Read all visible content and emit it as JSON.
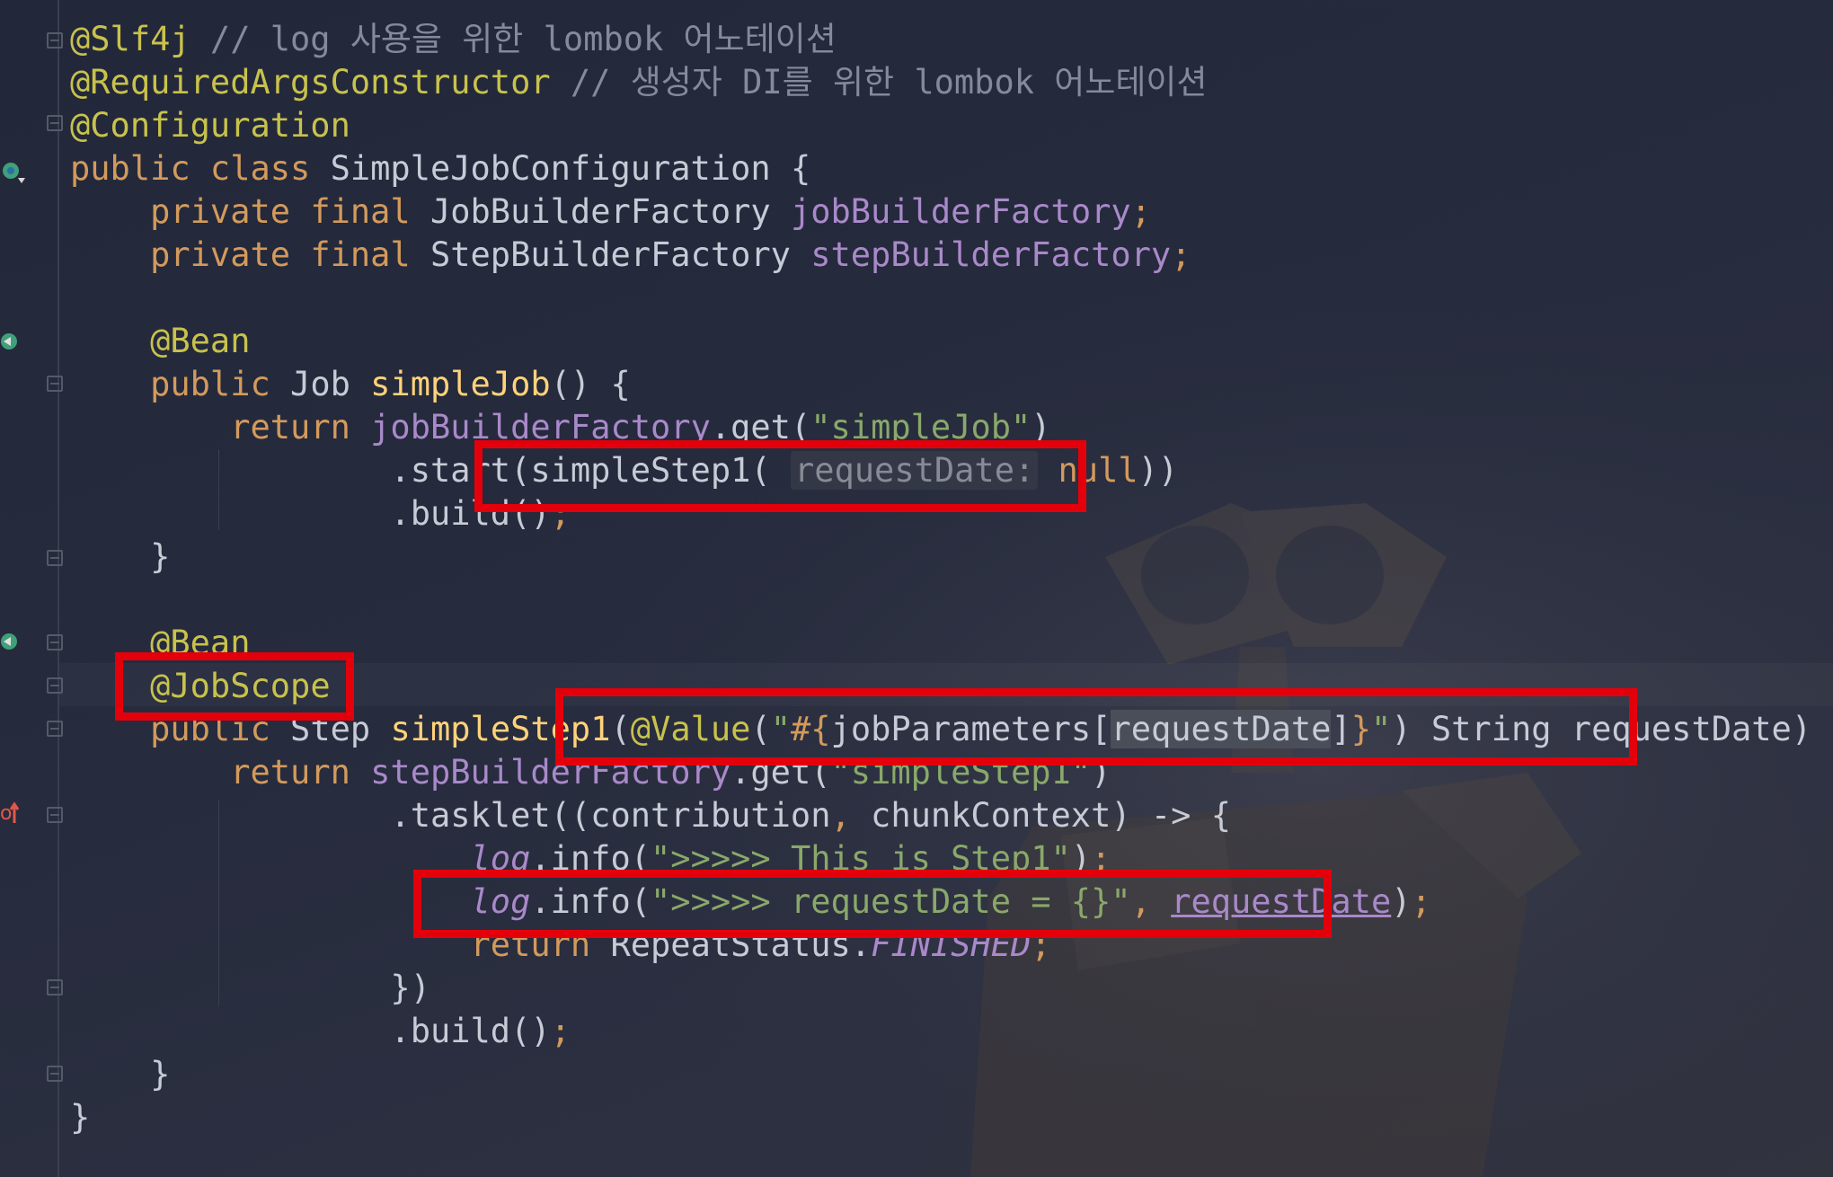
{
  "editor": {
    "lines": [
      [
        [
          "ann",
          "@Slf4j"
        ],
        [
          "cmt",
          " // log 사용을 위한 lombok 어노테이션"
        ]
      ],
      [
        [
          "ann",
          "@RequiredArgsConstructor"
        ],
        [
          "cmt",
          " // 생성자 DI를 위한 lombok 어노테이션"
        ]
      ],
      [
        [
          "ann",
          "@Configuration"
        ]
      ],
      [
        [
          "kw",
          "public class "
        ],
        [
          "",
          "SimpleJobConfiguration {"
        ]
      ],
      [
        [
          "",
          "    "
        ],
        [
          "kw",
          "private final "
        ],
        [
          "",
          "JobBuilderFactory "
        ],
        [
          "fld",
          "jobBuilderFactory"
        ],
        [
          "kw",
          ";"
        ]
      ],
      [
        [
          "",
          "    "
        ],
        [
          "kw",
          "private final "
        ],
        [
          "",
          "StepBuilderFactory "
        ],
        [
          "fld",
          "stepBuilderFactory"
        ],
        [
          "kw",
          ";"
        ]
      ],
      [],
      [
        [
          "",
          "    "
        ],
        [
          "ann",
          "@Bean"
        ]
      ],
      [
        [
          "",
          "    "
        ],
        [
          "kw",
          "public "
        ],
        [
          "",
          "Job "
        ],
        [
          "fn",
          "simpleJob"
        ],
        [
          "",
          "() {"
        ]
      ],
      [
        [
          "",
          "        "
        ],
        [
          "kw",
          "return "
        ],
        [
          "fld",
          "jobBuilderFactory"
        ],
        [
          "",
          ".get("
        ],
        [
          "str",
          "\"simpleJob\""
        ],
        [
          "",
          ")"
        ]
      ],
      [
        [
          "",
          "                .start(simpleStep1( "
        ],
        [
          "hint",
          "requestDate:"
        ],
        [
          "kw",
          " null"
        ],
        [
          "",
          "))"
        ]
      ],
      [
        [
          "",
          "                .build()"
        ],
        [
          "kw",
          ";"
        ]
      ],
      [
        [
          "",
          "    }"
        ]
      ],
      [],
      [
        [
          "",
          "    "
        ],
        [
          "ann",
          "@Bean"
        ]
      ],
      [
        [
          "",
          "    "
        ],
        [
          "ann",
          "@JobScope"
        ]
      ],
      [
        [
          "",
          "    "
        ],
        [
          "kw",
          "public "
        ],
        [
          "",
          "Step "
        ],
        [
          "fn",
          "simpleStep1"
        ],
        [
          "",
          "("
        ],
        [
          "ann",
          "@Value"
        ],
        [
          "",
          "("
        ],
        [
          "str",
          "\""
        ],
        [
          "kw",
          "#{"
        ],
        [
          "",
          "jobParameters["
        ],
        [
          "sel",
          "requestDate"
        ],
        [
          "",
          "]"
        ],
        [
          "kw",
          "}"
        ],
        [
          "str",
          "\""
        ],
        [
          "",
          ") String requestDate) {"
        ]
      ],
      [
        [
          "",
          "        "
        ],
        [
          "kw",
          "return "
        ],
        [
          "fld",
          "stepBuilderFactory"
        ],
        [
          "",
          ".get("
        ],
        [
          "str",
          "\"simpleStep1\""
        ],
        [
          "",
          ")"
        ]
      ],
      [
        [
          "",
          "                .tasklet((contribution"
        ],
        [
          "kw",
          ", "
        ],
        [
          "",
          "chunkContext) -> {"
        ]
      ],
      [
        [
          "",
          "                    "
        ],
        [
          "it",
          "log"
        ],
        [
          "",
          ".info("
        ],
        [
          "str",
          "\">>>>> This is Step1\""
        ],
        [
          "",
          ")"
        ],
        [
          "kw",
          ";"
        ]
      ],
      [
        [
          "",
          "                    "
        ],
        [
          "it",
          "log"
        ],
        [
          "",
          ".info("
        ],
        [
          "str",
          "\">>>>> requestDate = {}\""
        ],
        [
          "kw",
          ", "
        ],
        [
          "fld und",
          "requestDate"
        ],
        [
          "",
          ")"
        ],
        [
          "kw",
          ";"
        ]
      ],
      [
        [
          "",
          "                    "
        ],
        [
          "kw",
          "return "
        ],
        [
          "",
          "RepeatStatus."
        ],
        [
          "it",
          "FINISHED"
        ],
        [
          "kw",
          ";"
        ]
      ],
      [
        [
          "",
          "                })"
        ]
      ],
      [
        [
          "",
          "                .build()"
        ],
        [
          "kw",
          ";"
        ]
      ],
      [
        [
          "",
          "    }"
        ]
      ],
      [
        [
          "",
          "}"
        ]
      ]
    ]
  },
  "colors": {
    "highlight_box": "#e3000b",
    "annotation": "#c8c24c",
    "keyword": "#d39a5c",
    "field": "#a989c9",
    "string": "#89a86a",
    "method": "#ffd27a",
    "comment": "#838a9a"
  },
  "icons": [
    "spring-config-icon",
    "bean-gutter-icon",
    "bean-gutter-icon",
    "override-gutter-icon",
    "fold-marker-icon"
  ]
}
